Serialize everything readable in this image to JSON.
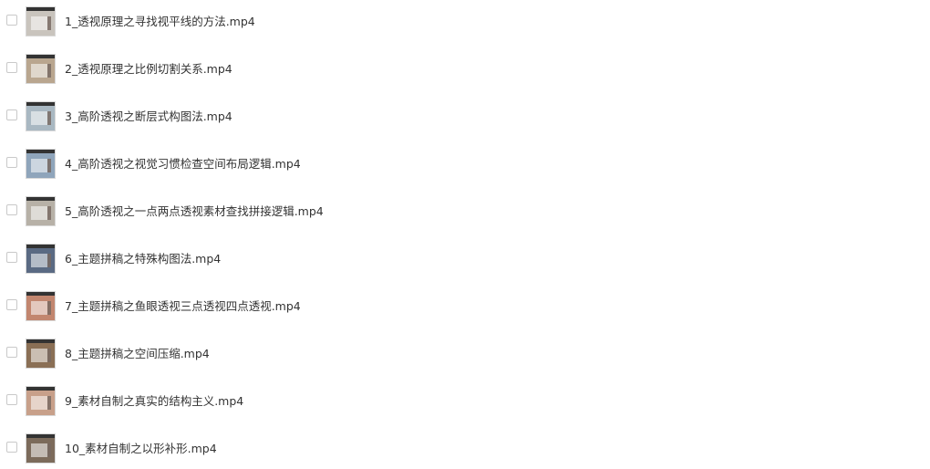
{
  "files": [
    {
      "name": "1_透视原理之寻找视平线的方法.mp4",
      "thumb_icon": "video-thumbnail-icon",
      "thumb_color": "#c9c4bd"
    },
    {
      "name": "2_透视原理之比例切割关系.mp4",
      "thumb_icon": "video-thumbnail-icon",
      "thumb_color": "#b9a68f"
    },
    {
      "name": "3_高阶透视之断层式构图法.mp4",
      "thumb_icon": "video-thumbnail-icon",
      "thumb_color": "#a9b8c2"
    },
    {
      "name": "4_高阶透视之视觉习惯检查空间布局逻辑.mp4",
      "thumb_icon": "video-thumbnail-icon",
      "thumb_color": "#8fa5bb"
    },
    {
      "name": "5_高阶透视之一点两点透视素材查找拼接逻辑.mp4",
      "thumb_icon": "video-thumbnail-icon",
      "thumb_color": "#b7b1a7"
    },
    {
      "name": "6_主题拼稿之特殊构图法.mp4",
      "thumb_icon": "video-thumbnail-icon",
      "thumb_color": "#5a6a83"
    },
    {
      "name": "7_主题拼稿之鱼眼透视三点透视四点透视.mp4",
      "thumb_icon": "video-thumbnail-icon",
      "thumb_color": "#c2866f"
    },
    {
      "name": "8_主题拼稿之空间压缩.mp4",
      "thumb_icon": "video-thumbnail-icon",
      "thumb_color": "#8a6f55"
    },
    {
      "name": "9_素材自制之真实的结构主义.mp4",
      "thumb_icon": "video-thumbnail-icon",
      "thumb_color": "#c8a08a"
    },
    {
      "name": "10_素材自制之以形补形.mp4",
      "thumb_icon": "video-thumbnail-icon",
      "thumb_color": "#7c6b5b"
    }
  ]
}
